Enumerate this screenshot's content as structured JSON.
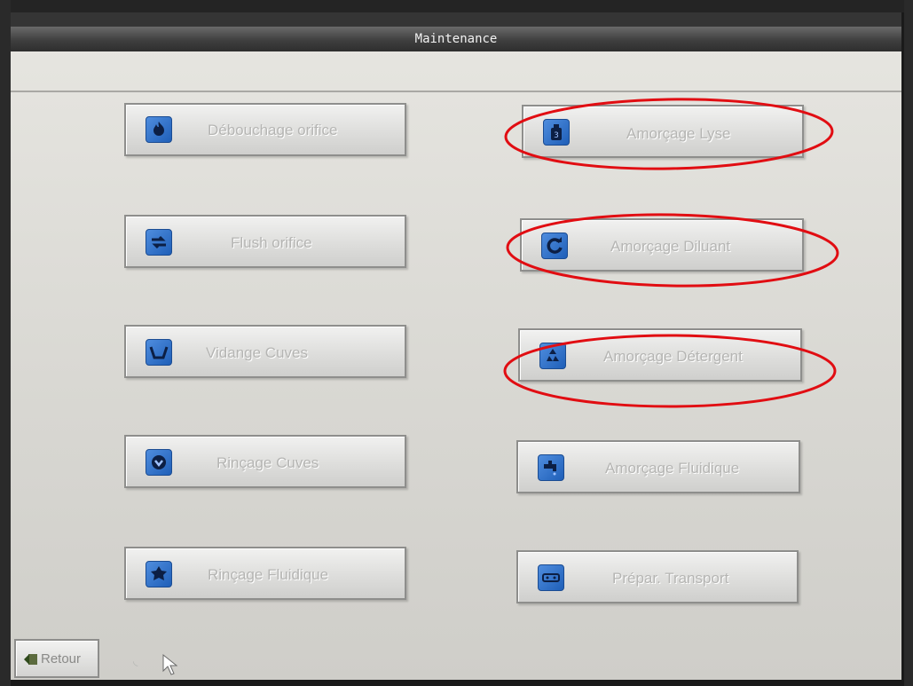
{
  "window": {
    "title": "Maintenance"
  },
  "buttons": [
    {
      "label": "Débouchage orifice",
      "icon": "fire-icon"
    },
    {
      "label": "Amorçage Lyse",
      "icon": "bottle-icon"
    },
    {
      "label": "Flush orifice",
      "icon": "arrows-swap-icon"
    },
    {
      "label": "Amorçage Diluant",
      "icon": "circular-arrow-icon"
    },
    {
      "label": "Vidange Cuves",
      "icon": "tank-empty-icon"
    },
    {
      "label": "Amorçage Détergent",
      "icon": "recycle-icon"
    },
    {
      "label": "Rinçage Cuves",
      "icon": "tank-rinse-icon"
    },
    {
      "label": "Amorçage Fluidique",
      "icon": "faucet-icon"
    },
    {
      "label": "Rinçage Fluidique",
      "icon": "fluidic-rinse-icon"
    },
    {
      "label": "Prépar. Transport",
      "icon": "transport-icon"
    }
  ],
  "footer": {
    "back_label": "Retour",
    "back_icon": "back-arrow-icon"
  },
  "colors": {
    "annotation": "#e10d12",
    "icon_blue": "#2d6fd0",
    "title_bar": "#3a3a3a"
  }
}
